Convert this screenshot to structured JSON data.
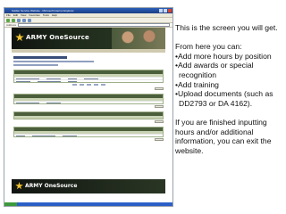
{
  "screenshot": {
    "window_title": "Soldier Service Website - Microsoft Internet Explorer",
    "menu_items": [
      "File",
      "Edit",
      "View",
      "Favorites",
      "Tools",
      "Help"
    ],
    "address_label": "Address",
    "brand_logo": "ARMY OneSource"
  },
  "instructions": {
    "intro": "This is the screen you will get.",
    "lead": "From here you can:",
    "bullets": [
      "Add more hours by position",
      "Add awards or special recognition",
      "Add training",
      "Upload documents (such as DD2793 or DA 4162)."
    ],
    "closing": "If you are finished inputting hours and/or additional information, you can exit the website."
  }
}
